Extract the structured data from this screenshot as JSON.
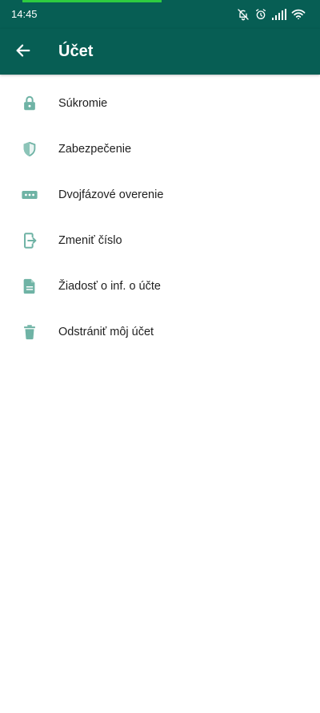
{
  "colors": {
    "header_bg": "#075e54",
    "icon_tint": "#6fb3a5",
    "progress": "#2ecc40",
    "text_primary": "#1f1f1f"
  },
  "status_bar": {
    "time": "14:45",
    "icons": [
      "bell-off-icon",
      "alarm-icon",
      "signal-icon",
      "wifi-icon"
    ]
  },
  "app_bar": {
    "back_icon": "arrow-left-icon",
    "title": "Účet"
  },
  "menu": {
    "items": [
      {
        "label": "Súkromie",
        "icon": "lock-icon"
      },
      {
        "label": "Zabezpečenie",
        "icon": "shield-icon"
      },
      {
        "label": "Dvojfázové overenie",
        "icon": "password-dots-icon"
      },
      {
        "label": "Zmeniť číslo",
        "icon": "change-number-icon"
      },
      {
        "label": "Žiadosť o inf. o účte",
        "icon": "document-icon"
      },
      {
        "label": "Odstrániť môj účet",
        "icon": "trash-icon"
      }
    ]
  }
}
